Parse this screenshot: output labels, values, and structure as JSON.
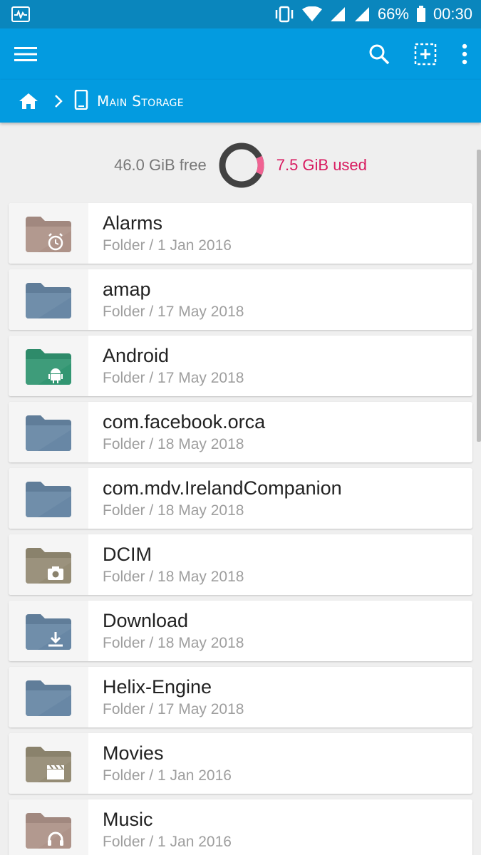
{
  "status_bar": {
    "battery_percent": "66%",
    "time": "00:30"
  },
  "toolbar": {
    "menu_icon": "hamburger-menu-icon",
    "search_icon": "search-icon",
    "select_icon": "add-selection-icon",
    "more_icon": "more-vertical-icon"
  },
  "breadcrumb": {
    "home_icon": "home-icon",
    "location_label": "Main Storage"
  },
  "storage": {
    "free_text": "46.0 GiB free",
    "used_text": "7.5 GiB used",
    "used_fraction": 0.14,
    "colors": {
      "free": "#424242",
      "used": "#f06292"
    }
  },
  "colors": {
    "toolbar": "#039be0",
    "status_bar": "#0a86bd"
  },
  "files": [
    {
      "name": "Alarms",
      "meta": "Folder / 1 Jan 2016",
      "icon": "folder-alarm-icon",
      "color": "#a1887f"
    },
    {
      "name": "amap",
      "meta": "Folder / 17 May 2018",
      "icon": "folder-icon",
      "color": "#607d99"
    },
    {
      "name": "Android",
      "meta": "Folder / 17 May 2018",
      "icon": "folder-android-icon",
      "color": "#2e8b6a"
    },
    {
      "name": "com.facebook.orca",
      "meta": "Folder / 18 May 2018",
      "icon": "folder-icon",
      "color": "#607d99"
    },
    {
      "name": "com.mdv.IrelandCompanion",
      "meta": "Folder / 18 May 2018",
      "icon": "folder-icon",
      "color": "#607d99"
    },
    {
      "name": "DCIM",
      "meta": "Folder / 18 May 2018",
      "icon": "folder-camera-icon",
      "color": "#8a826c"
    },
    {
      "name": "Download",
      "meta": "Folder / 18 May 2018",
      "icon": "folder-download-icon",
      "color": "#607d99"
    },
    {
      "name": "Helix-Engine",
      "meta": "Folder / 17 May 2018",
      "icon": "folder-icon",
      "color": "#607d99"
    },
    {
      "name": "Movies",
      "meta": "Folder / 1 Jan 2016",
      "icon": "folder-movie-icon",
      "color": "#8a826c"
    },
    {
      "name": "Music",
      "meta": "Folder / 1 Jan 2016",
      "icon": "folder-music-icon",
      "color": "#a1887f"
    }
  ]
}
